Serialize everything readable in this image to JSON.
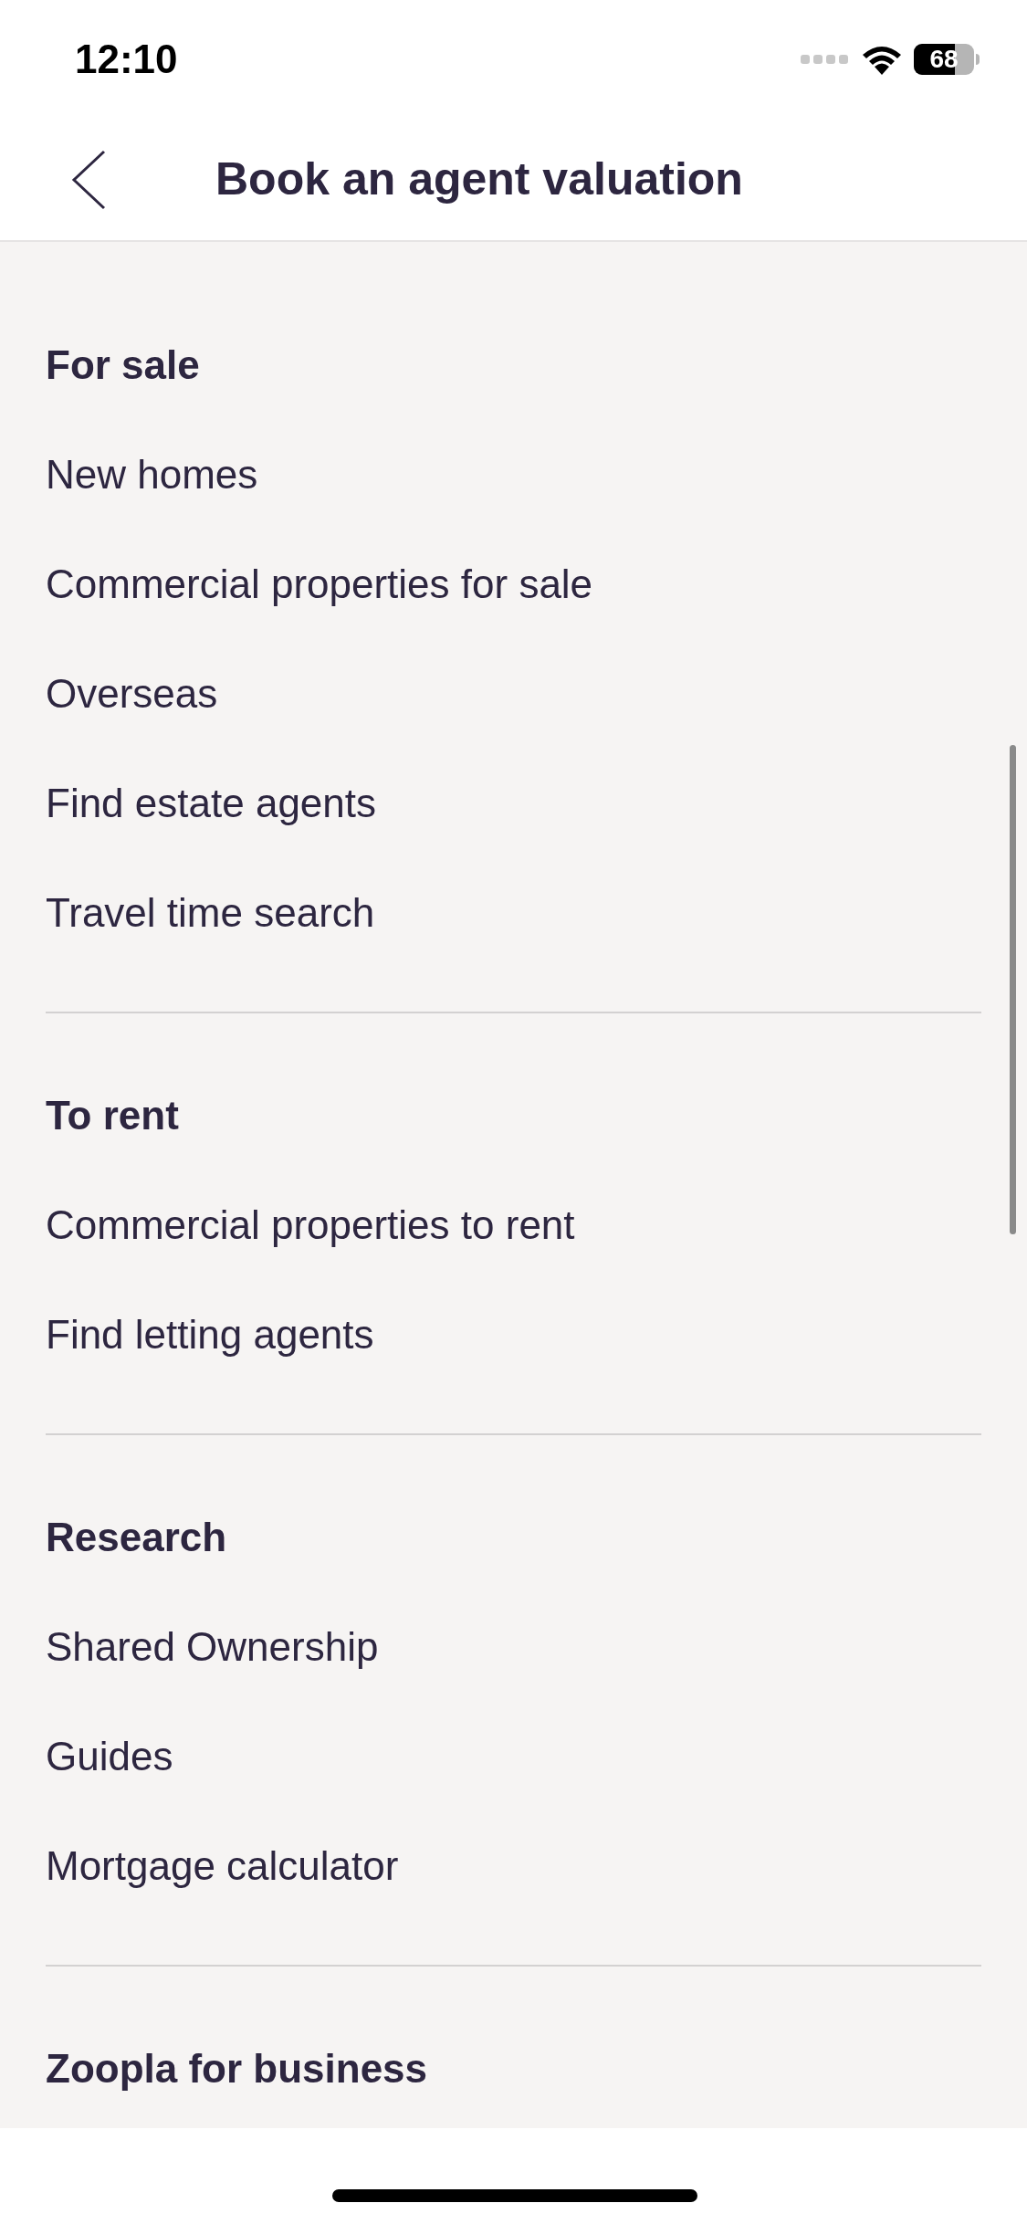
{
  "status_bar": {
    "time": "12:10",
    "battery": "68"
  },
  "header": {
    "title": "Book an agent valuation"
  },
  "sections": [
    {
      "heading": "For sale",
      "items": [
        "New homes",
        "Commercial properties for sale",
        "Overseas",
        "Find estate agents",
        "Travel time search"
      ]
    },
    {
      "heading": "To rent",
      "items": [
        "Commercial properties to rent",
        "Find letting agents"
      ]
    },
    {
      "heading": "Research",
      "items": [
        "Shared Ownership",
        "Guides",
        "Mortgage calculator"
      ]
    },
    {
      "heading": "Zoopla for business"
    }
  ]
}
